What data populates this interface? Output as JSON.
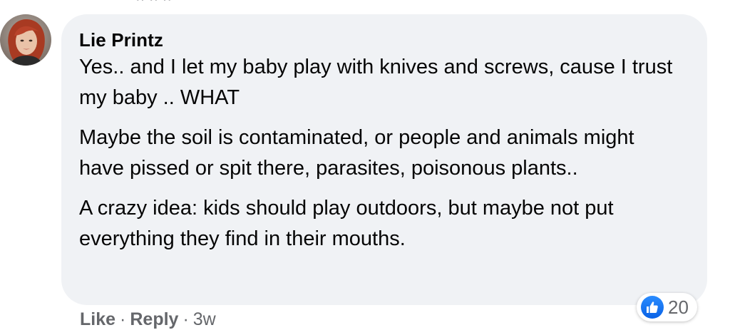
{
  "comment": {
    "author": "Lie Printz",
    "paragraphs": [
      "Yes.. and I let my baby play with knives and screws, cause I trust my baby .. WHAT",
      "Maybe the soil is contaminated, or people and animals might have pissed or spit there, parasites, poisonous plants..",
      "A crazy idea: kids should play outdoors, but maybe not put everything they find in their mouths."
    ],
    "reactions": {
      "icon": "thumbs-up-icon",
      "count": "20",
      "color": "#1877f2"
    },
    "actions": {
      "like_label": "Like",
      "reply_label": "Reply",
      "separator": "·",
      "timestamp": "3w"
    }
  }
}
